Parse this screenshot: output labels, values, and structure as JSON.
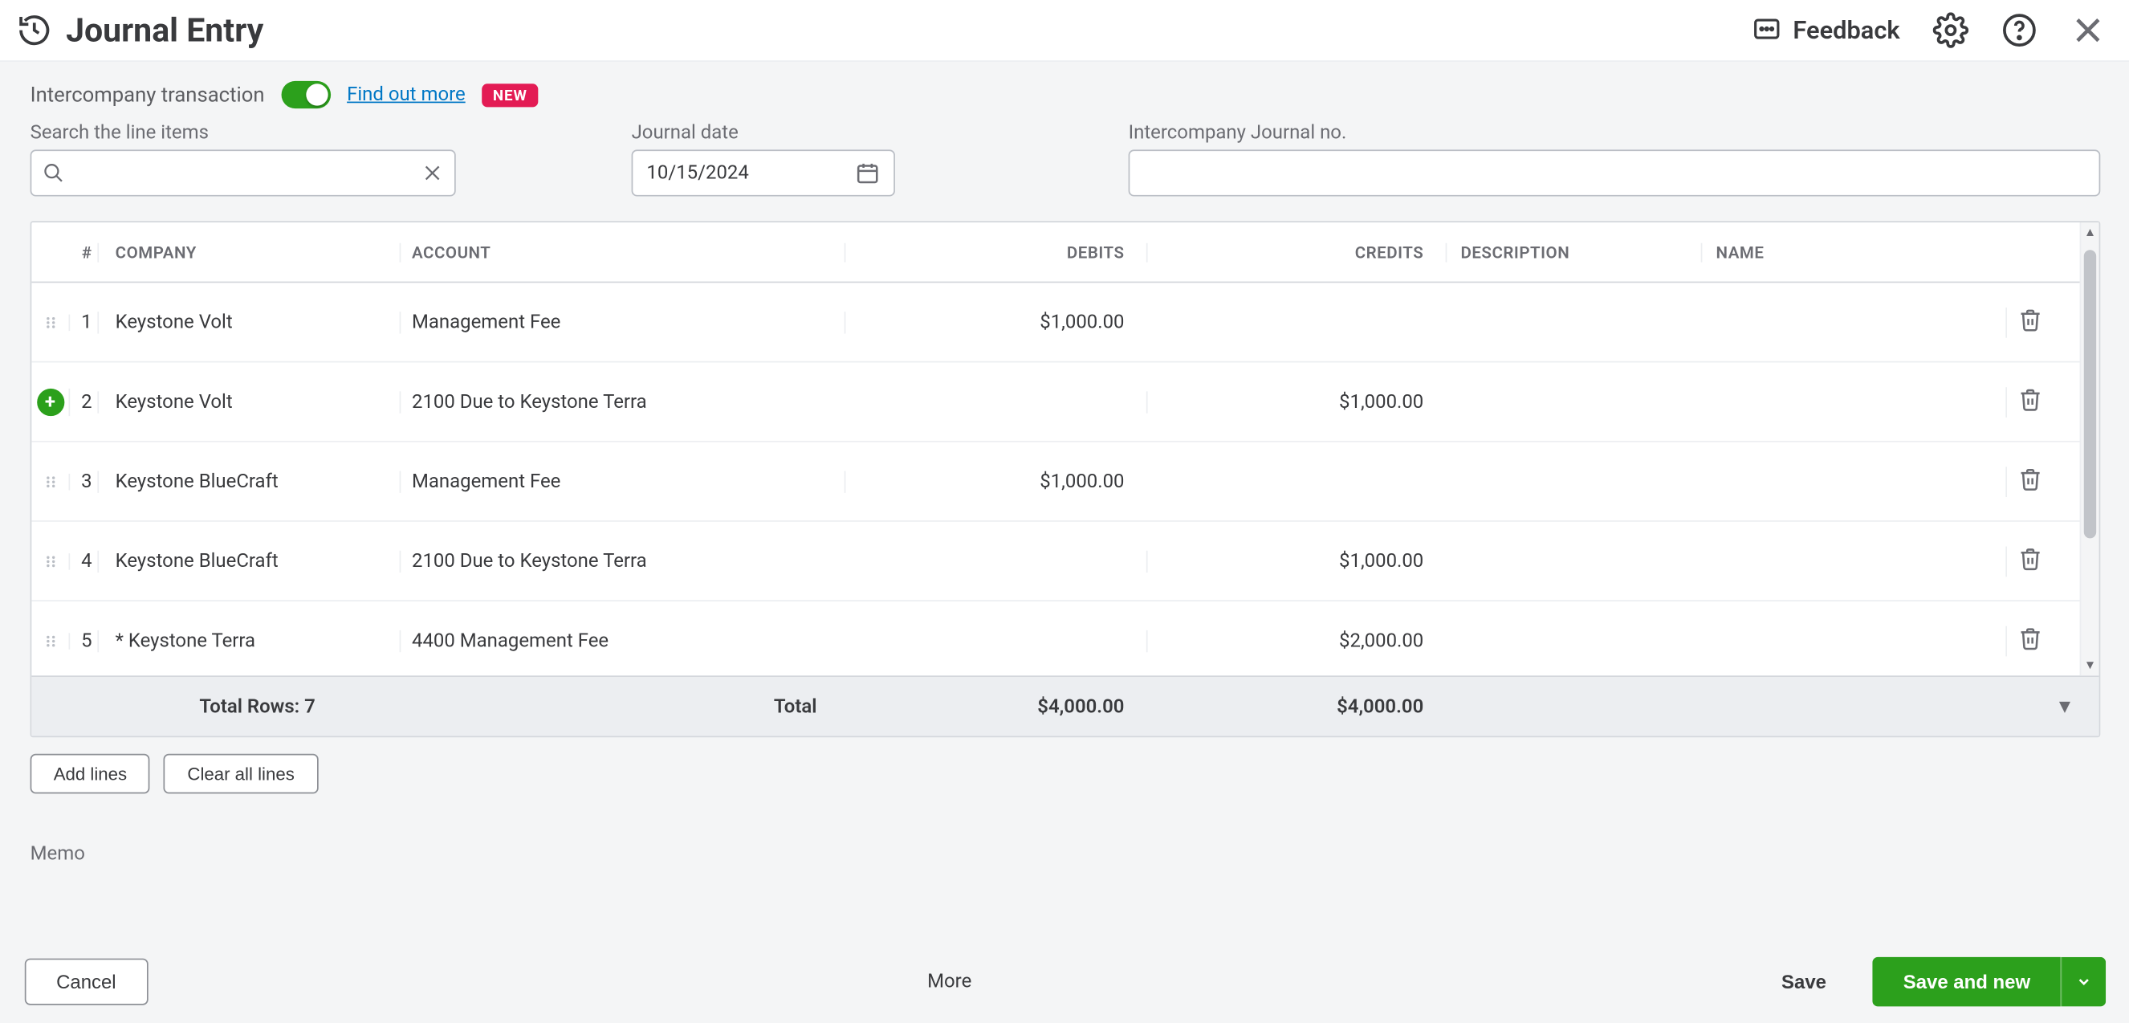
{
  "header": {
    "title": "Journal Entry",
    "feedback_label": "Feedback"
  },
  "intercompany": {
    "label": "Intercompany transaction",
    "find_out_more": "Find out more",
    "new_badge": "NEW"
  },
  "fields": {
    "search": {
      "label": "Search the line items",
      "value": ""
    },
    "date": {
      "label": "Journal date",
      "value": "10/15/2024"
    },
    "journal_no": {
      "label": "Intercompany Journal no.",
      "value": ""
    }
  },
  "columns": {
    "num": "#",
    "company": "COMPANY",
    "account": "ACCOUNT",
    "debits": "DEBITS",
    "credits": "CREDITS",
    "description": "DESCRIPTION",
    "name": "NAME"
  },
  "rows": [
    {
      "num": "1",
      "company": "Keystone Volt",
      "account": "Management Fee",
      "debit": "$1,000.00",
      "credit": "",
      "add_badge": false
    },
    {
      "num": "2",
      "company": "Keystone Volt",
      "account": "2100 Due to Keystone Terra",
      "debit": "",
      "credit": "$1,000.00",
      "add_badge": true
    },
    {
      "num": "3",
      "company": "Keystone BlueCraft",
      "account": "Management Fee",
      "debit": "$1,000.00",
      "credit": "",
      "add_badge": false
    },
    {
      "num": "4",
      "company": "Keystone BlueCraft",
      "account": "2100 Due to Keystone Terra",
      "debit": "",
      "credit": "$1,000.00",
      "add_badge": false
    },
    {
      "num": "5",
      "company": "* Keystone Terra",
      "account": "4400 Management Fee",
      "debit": "",
      "credit": "$2,000.00",
      "add_badge": false
    }
  ],
  "totals": {
    "row_count_label": "Total Rows: 7",
    "total_label": "Total",
    "debit_total": "$4,000.00",
    "credit_total": "$4,000.00"
  },
  "below_table": {
    "add_lines": "Add lines",
    "clear_all": "Clear all lines"
  },
  "memo_label": "Memo",
  "footer": {
    "cancel": "Cancel",
    "more": "More",
    "save": "Save",
    "save_and_new": "Save and new"
  }
}
